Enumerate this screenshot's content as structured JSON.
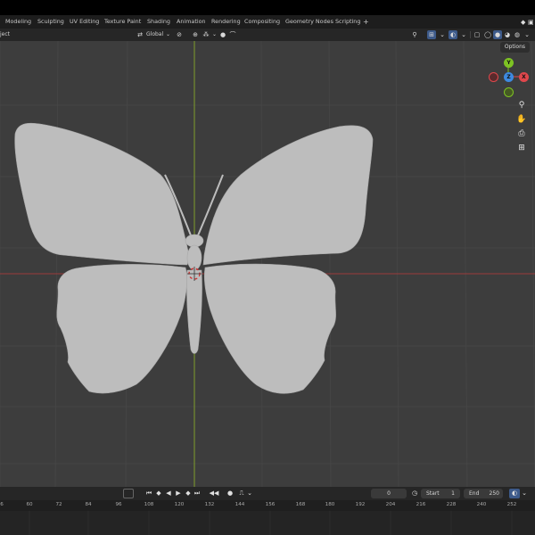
{
  "workspace_tabs": [
    {
      "label": "Modeling",
      "active": false
    },
    {
      "label": "Sculpting",
      "active": false
    },
    {
      "label": "UV Editing",
      "active": false
    },
    {
      "label": "Texture Paint",
      "active": false
    },
    {
      "label": "Shading",
      "active": false
    },
    {
      "label": "Animation",
      "active": false
    },
    {
      "label": "Rendering",
      "active": false
    },
    {
      "label": "Compositing",
      "active": false
    },
    {
      "label": "Geometry Nodes",
      "active": false
    },
    {
      "label": "Scripting",
      "active": false
    }
  ],
  "add_tab_label": "+",
  "viewport_header": {
    "object_menu_label": "ject",
    "transform_orientation": "Global",
    "options_label": "Options"
  },
  "gizmo": {
    "x_label": "X",
    "y_label": "Y",
    "z_label": "Z",
    "x_color": "#e0474c",
    "y_color": "#7ec323",
    "z_color": "#3d8ae0"
  },
  "timeline": {
    "current_frame": "0",
    "start_label": "Start",
    "start_value": "1",
    "end_label": "End",
    "end_value": "250",
    "ruler_ticks": [
      "6",
      "60",
      "72",
      "84",
      "96",
      "108",
      "120",
      "132",
      "144",
      "156",
      "168",
      "180",
      "192",
      "204",
      "216",
      "228",
      "240",
      "252"
    ]
  },
  "colors": {
    "accent": "#3d5a8a",
    "viewport_bg": "#3d3d3d",
    "model": "#bdbdbd",
    "x_axis": "#9c3b3b",
    "y_axis": "#7f9d2c"
  }
}
